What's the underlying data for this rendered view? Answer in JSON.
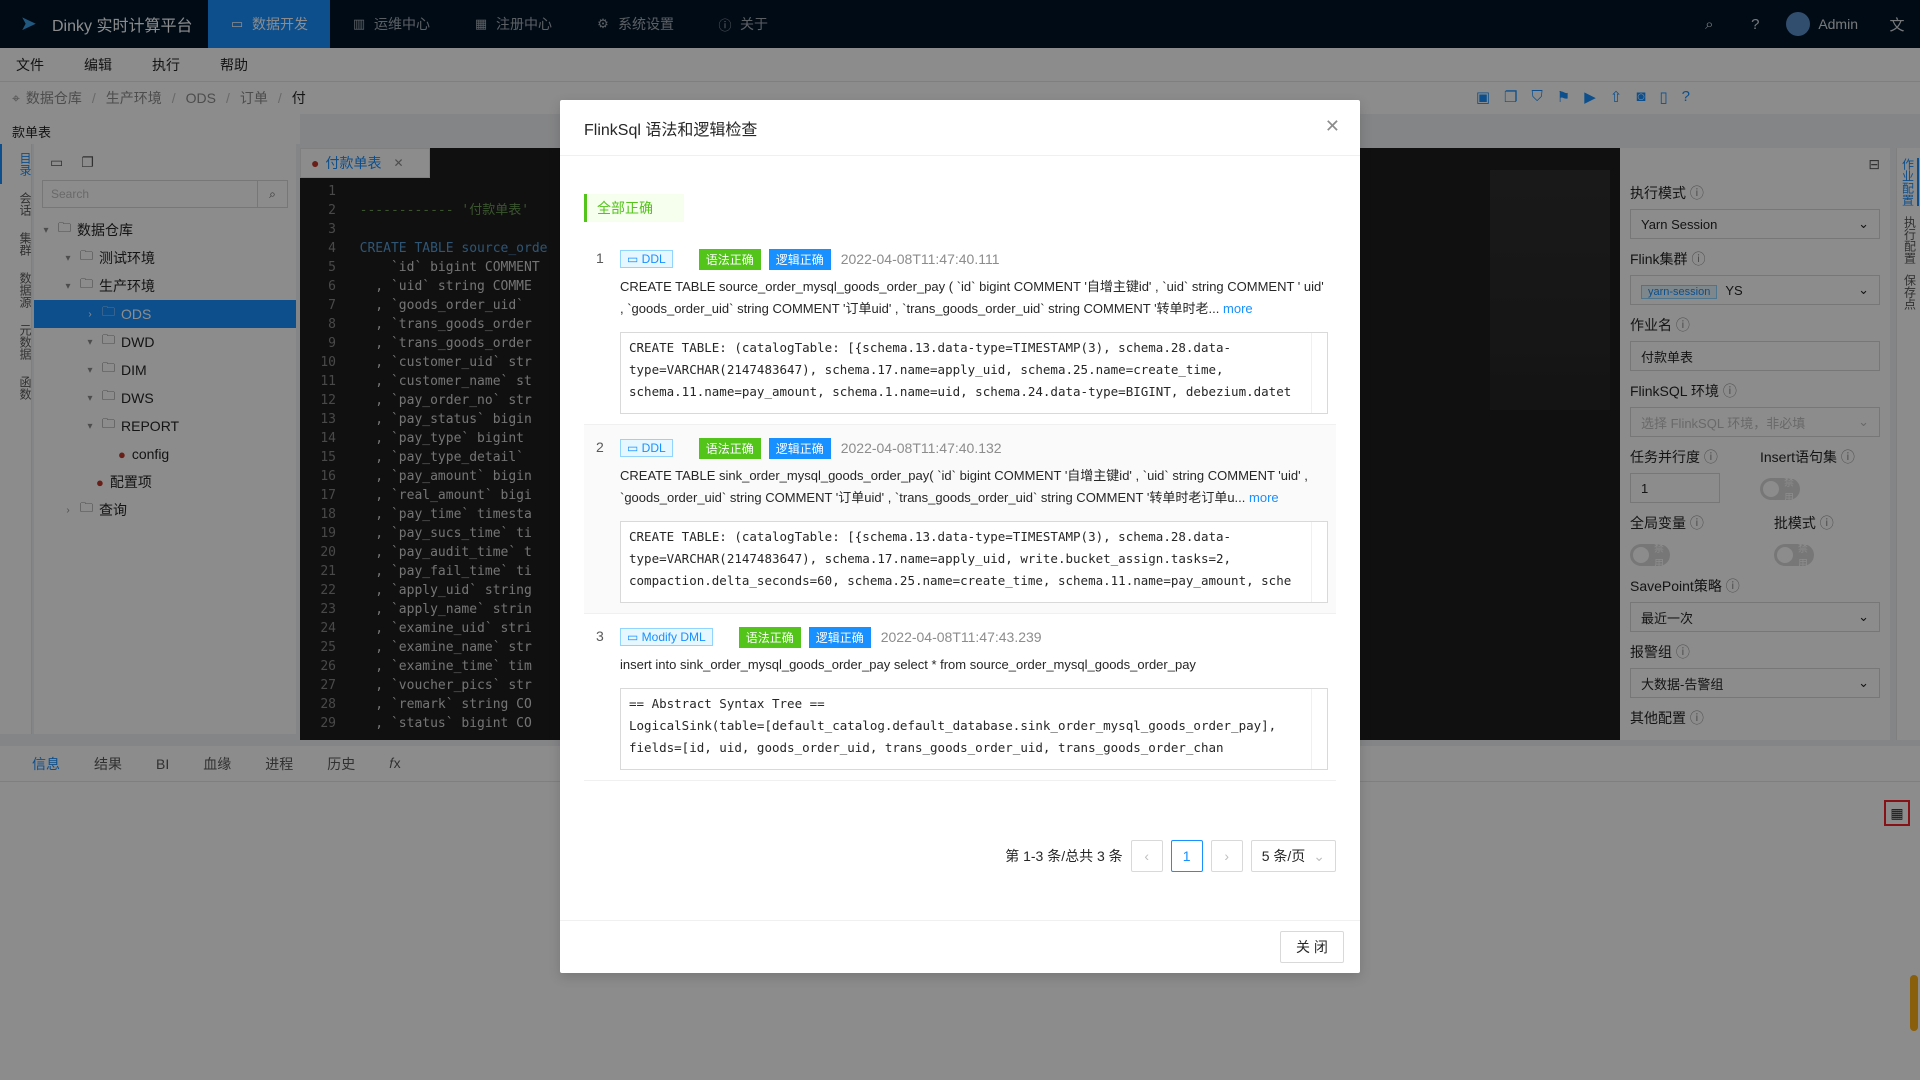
{
  "app": {
    "title": "Dinky 实时计算平台"
  },
  "nav": {
    "items": [
      {
        "label": "数据开发",
        "icon": "code-icon"
      },
      {
        "label": "运维中心",
        "icon": "dashboard-icon"
      },
      {
        "label": "注册中心",
        "icon": "grid-icon"
      },
      {
        "label": "系统设置",
        "icon": "gear-icon"
      },
      {
        "label": "关于",
        "icon": "info-icon"
      }
    ]
  },
  "user": {
    "name": "Admin"
  },
  "menu": {
    "items": [
      "文件",
      "编辑",
      "执行",
      "帮助"
    ]
  },
  "breadcrumb": [
    "数据仓库",
    "生产环境",
    "ODS",
    "订单",
    "付"
  ],
  "job_title": "款单表",
  "leftbar": {
    "items": [
      "目录",
      "会话",
      "集群",
      "数据源",
      "元数据",
      "函数"
    ]
  },
  "tree": {
    "search_placeholder": "Search",
    "nodes": [
      "数据仓库",
      "测试环境",
      "生产环境",
      "ODS",
      "DWD",
      "DIM",
      "DWS",
      "REPORT",
      "config",
      "配置项",
      "查询"
    ]
  },
  "editor": {
    "tab": "付款单表",
    "lines": [
      {
        "n": "1",
        "t": ""
      },
      {
        "n": "2",
        "t": "------------ '付款单表'"
      },
      {
        "n": "3",
        "t": ""
      },
      {
        "n": "4",
        "t": "CREATE TABLE source_orde"
      },
      {
        "n": "5",
        "t": "    `id` bigint COMMENT"
      },
      {
        "n": "6",
        "t": "  , `uid` string COMME"
      },
      {
        "n": "7",
        "t": "  , `goods_order_uid`"
      },
      {
        "n": "8",
        "t": "  , `trans_goods_order"
      },
      {
        "n": "9",
        "t": "  , `trans_goods_order"
      },
      {
        "n": "10",
        "t": "  , `customer_uid` str"
      },
      {
        "n": "11",
        "t": "  , `customer_name` st"
      },
      {
        "n": "12",
        "t": "  , `pay_order_no` str"
      },
      {
        "n": "13",
        "t": "  , `pay_status` bigin"
      },
      {
        "n": "14",
        "t": "  , `pay_type` bigint"
      },
      {
        "n": "15",
        "t": "  , `pay_type_detail`"
      },
      {
        "n": "16",
        "t": "  , `pay_amount` bigin"
      },
      {
        "n": "17",
        "t": "  , `real_amount` bigi"
      },
      {
        "n": "18",
        "t": "  , `pay_time` timesta"
      },
      {
        "n": "19",
        "t": "  , `pay_sucs_time` ti"
      },
      {
        "n": "20",
        "t": "  , `pay_audit_time` t"
      },
      {
        "n": "21",
        "t": "  , `pay_fail_time` ti"
      },
      {
        "n": "22",
        "t": "  , `apply_uid` string"
      },
      {
        "n": "23",
        "t": "  , `apply_name` strin"
      },
      {
        "n": "24",
        "t": "  , `examine_uid` stri"
      },
      {
        "n": "25",
        "t": "  , `examine_name` str"
      },
      {
        "n": "26",
        "t": "  , `examine_time` tim"
      },
      {
        "n": "27",
        "t": "  , `voucher_pics` str"
      },
      {
        "n": "28",
        "t": "  , `remark` string CO"
      },
      {
        "n": "29",
        "t": "  , `status` bigint CO"
      }
    ]
  },
  "rightpanel": {
    "exec_mode_label": "执行模式",
    "exec_mode": "Yarn Session",
    "cluster_label": "Flink集群",
    "cluster_tag": "yarn-session",
    "cluster": "YS",
    "job_name_label": "作业名",
    "job_name": "付款单表",
    "env_label": "FlinkSQL 环境",
    "env_placeholder": "选择 FlinkSQL 环境，非必填",
    "parallel_label": "任务并行度",
    "parallel": "1",
    "insert_label": "Insert语句集",
    "insert_state": "禁用",
    "global_var_label": "全局变量",
    "global_var_state": "禁用",
    "batch_label": "批模式",
    "batch_state": "禁用",
    "savepoint_label": "SavePoint策略",
    "savepoint": "最近一次",
    "alert_label": "报警组",
    "alert": "大数据-告警组",
    "other_label": "其他配置"
  },
  "rightbar": {
    "items": [
      "作业配置",
      "执行配置",
      "保存点"
    ]
  },
  "bottom_tabs": [
    "信息",
    "结果",
    "BI",
    "血缘",
    "进程",
    "历史"
  ],
  "modal": {
    "title": "FlinkSql 语法和逻辑检查",
    "summary": "全部正确",
    "items": [
      {
        "num": "1",
        "type": "DDL",
        "syntax": "语法正确",
        "logic": "逻辑正确",
        "time": "2022-04-08T11:47:40.111",
        "sql": "CREATE TABLE source_order_mysql_goods_order_pay ( `id` bigint COMMENT '自增主键id' , `uid` string COMMENT ' uid' , `goods_order_uid` string COMMENT '订单uid' , `trans_goods_order_uid` string COMMENT '转单时老...",
        "more": "more",
        "result": "CREATE TABLE: (catalogTable: [{schema.13.data-type=TIMESTAMP(3), schema.28.data-type=VARCHAR(2147483647), schema.17.name=apply_uid, schema.25.name=create_time, schema.11.name=pay_amount, schema.1.name=uid, schema.24.data-type=BIGINT, debezium.datet"
      },
      {
        "num": "2",
        "type": "DDL",
        "syntax": "语法正确",
        "logic": "逻辑正确",
        "time": "2022-04-08T11:47:40.132",
        "sql": "CREATE TABLE sink_order_mysql_goods_order_pay( `id` bigint COMMENT '自增主键id' , `uid` string COMMENT 'uid' , `goods_order_uid` string COMMENT '订单uid' , `trans_goods_order_uid` string COMMENT '转单时老订单u...",
        "more": "more",
        "result": "CREATE TABLE: (catalogTable: [{schema.13.data-type=TIMESTAMP(3), schema.28.data-type=VARCHAR(2147483647), schema.17.name=apply_uid, write.bucket_assign.tasks=2, compaction.delta_seconds=60, schema.25.name=create_time, schema.11.name=pay_amount, sche"
      },
      {
        "num": "3",
        "type": "Modify DML",
        "syntax": "语法正确",
        "logic": "逻辑正确",
        "time": "2022-04-08T11:47:43.239",
        "sql": "insert into sink_order_mysql_goods_order_pay select * from source_order_mysql_goods_order_pay",
        "more": "",
        "result": "== Abstract Syntax Tree ==\nLogicalSink(table=[default_catalog.default_database.sink_order_mysql_goods_order_pay], fields=[id, uid, goods_order_uid, trans_goods_order_uid, trans_goods_order_chan"
      }
    ],
    "pagination": {
      "summary": "第 1-3 条/总共 3 条",
      "current": "1",
      "page_size": "5 条/页"
    },
    "close_label": "关 闭"
  }
}
